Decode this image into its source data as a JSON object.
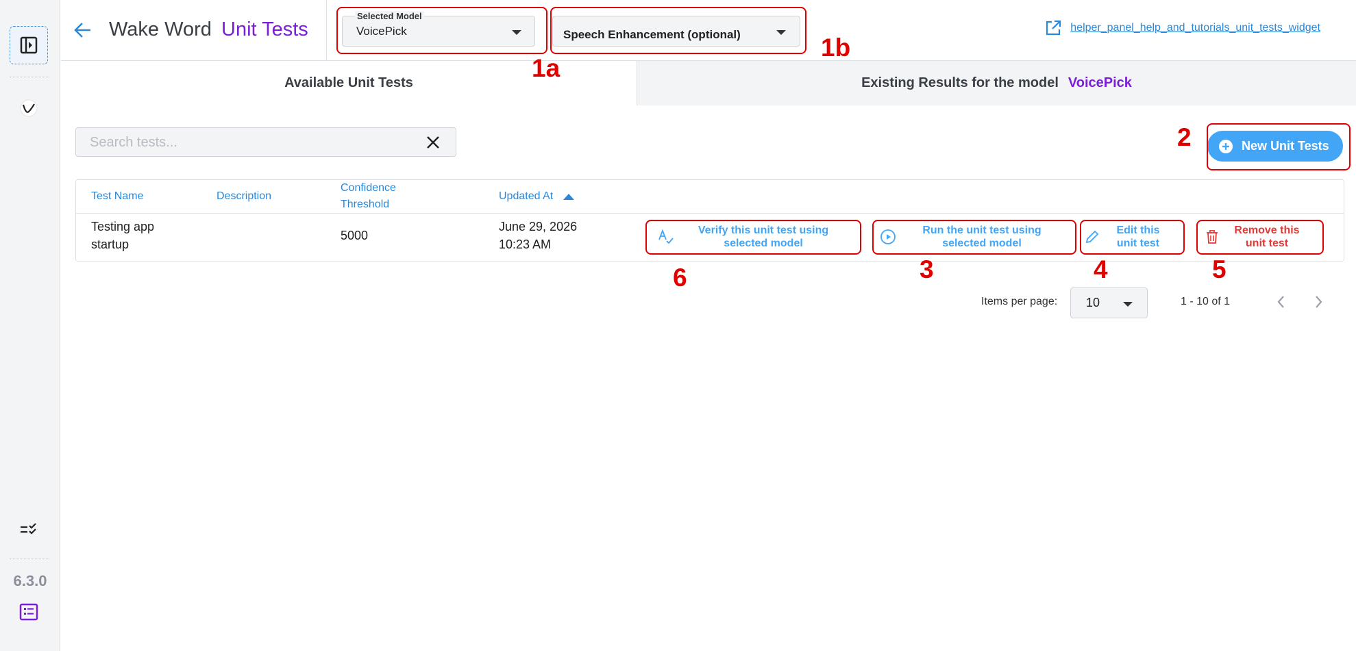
{
  "header": {
    "title_main": "Wake Word",
    "title_accent": "Unit Tests",
    "selected_model_label": "Selected Model",
    "selected_model_value": "VoicePick",
    "speech_enhancement_value": "Speech Enhancement (optional)",
    "help_link": "helper_panel_help_and_tutorials_unit_tests_widget"
  },
  "sidebar": {
    "version": "6.3.0"
  },
  "tabs": {
    "available": "Available Unit Tests",
    "existing": "Existing Results for the model",
    "existing_model": "VoicePick"
  },
  "search": {
    "placeholder": "Search tests..."
  },
  "new_button": {
    "label": "New Unit Tests"
  },
  "table": {
    "columns": {
      "test_name": "Test Name",
      "description": "Description",
      "confidence_line1": "Confidence",
      "confidence_line2": "Threshold",
      "updated_at": "Updated At"
    },
    "rows": [
      {
        "name_line1": "Testing app",
        "name_line2": "startup",
        "description": "",
        "confidence": "5000",
        "updated_line1": "June 29, 2026",
        "updated_line2": "10:23 AM"
      }
    ]
  },
  "actions": {
    "verify_line1": "Verify this unit test using",
    "verify_line2": "selected model",
    "run_line1": "Run the unit test using",
    "run_line2": "selected model",
    "edit_line1": "Edit this",
    "edit_line2": "unit test",
    "remove_line1": "Remove this",
    "remove_line2": "unit test"
  },
  "pagination": {
    "items_per_page_label": "Items per page:",
    "items_per_page": "10",
    "range": "1 - 10 of 1"
  },
  "annotations": {
    "a1a": "1a",
    "a1b": "1b",
    "a2": "2",
    "a3": "3",
    "a4": "4",
    "a5": "5",
    "a6": "6"
  },
  "colors": {
    "accent_purple": "#7b1fd6",
    "link_blue": "#2b88d8",
    "primary_blue": "#42a5f5",
    "danger_red": "#e53935",
    "annotation_red": "#e00000"
  }
}
